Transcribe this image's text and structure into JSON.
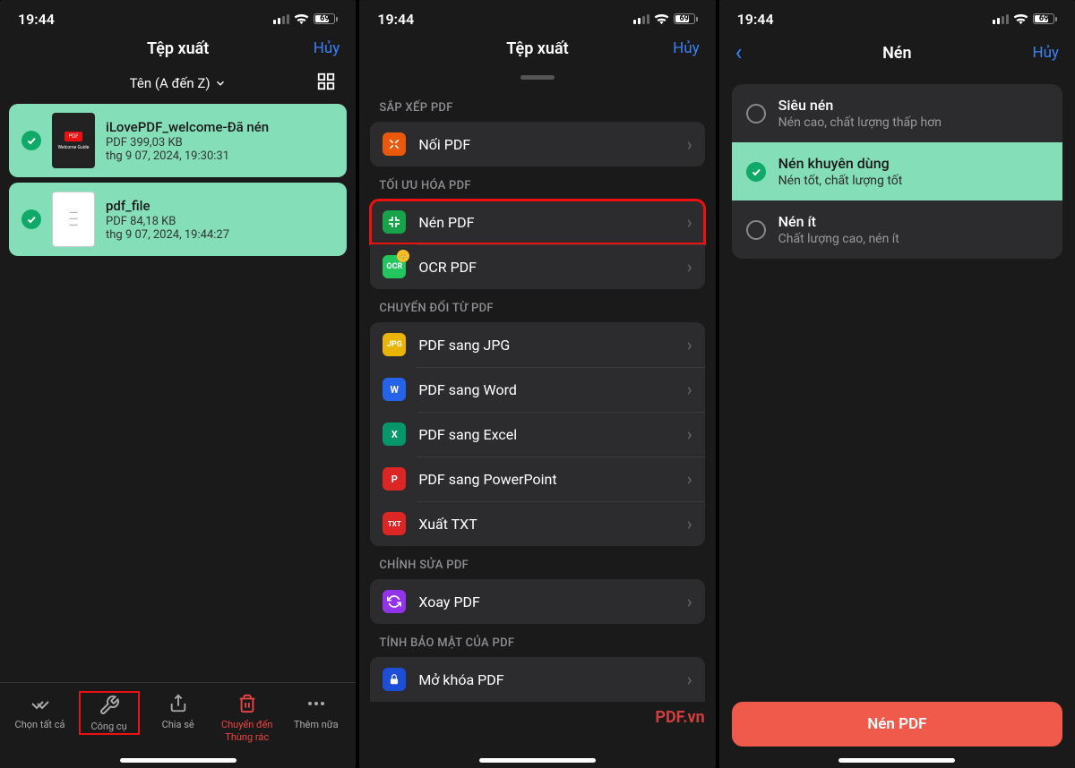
{
  "status": {
    "time": "19:44",
    "battery": "69"
  },
  "screen1": {
    "title": "Tệp xuất",
    "cancel": "Hủy",
    "sort": "Tên (A đến Z)",
    "files": [
      {
        "name": "iLovePDF_welcome-Đã nén",
        "meta": "PDF 399,03 KB",
        "date": "thg 9 07, 2024, 19:30:31"
      },
      {
        "name": "pdf_file",
        "meta": "PDF 84,18 KB",
        "date": "thg 9 07, 2024, 19:44:27"
      }
    ],
    "toolbar": {
      "selectAll": "Chọn tất cả",
      "tools": "Công cụ",
      "share": "Chia sẻ",
      "trash1": "Chuyển đến",
      "trash2": "Thùng rác",
      "more": "Thêm nữa"
    }
  },
  "screen2": {
    "title": "Tệp xuất",
    "cancel": "Hủy",
    "sections": {
      "arrange": "SẮP XẾP PDF",
      "optimize": "TỐI ƯU HÓA PDF",
      "convertFrom": "CHUYỂN ĐỔI TỪ PDF",
      "edit": "CHỈNH SỬA PDF",
      "security": "TÍNH BẢO MẬT CỦA PDF"
    },
    "tools": {
      "merge": "Nối PDF",
      "compress": "Nén PDF",
      "ocr": "OCR PDF",
      "toJpg": "PDF sang JPG",
      "toWord": "PDF sang Word",
      "toExcel": "PDF sang Excel",
      "toPpt": "PDF sang PowerPoint",
      "toTxt": "Xuất TXT",
      "rotate": "Xoay PDF",
      "unlock": "Mở khóa PDF"
    }
  },
  "screen3": {
    "title": "Nén",
    "cancel": "Hủy",
    "options": [
      {
        "title": "Siêu nén",
        "sub": "Nén cao, chất lượng thấp hơn"
      },
      {
        "title": "Nén khuyên dùng",
        "sub": "Nén tốt, chất lượng tốt"
      },
      {
        "title": "Nén ít",
        "sub": "Chất lượng cao, nén ít"
      }
    ],
    "action": "Nén PDF"
  },
  "watermark": "PDF.vn"
}
